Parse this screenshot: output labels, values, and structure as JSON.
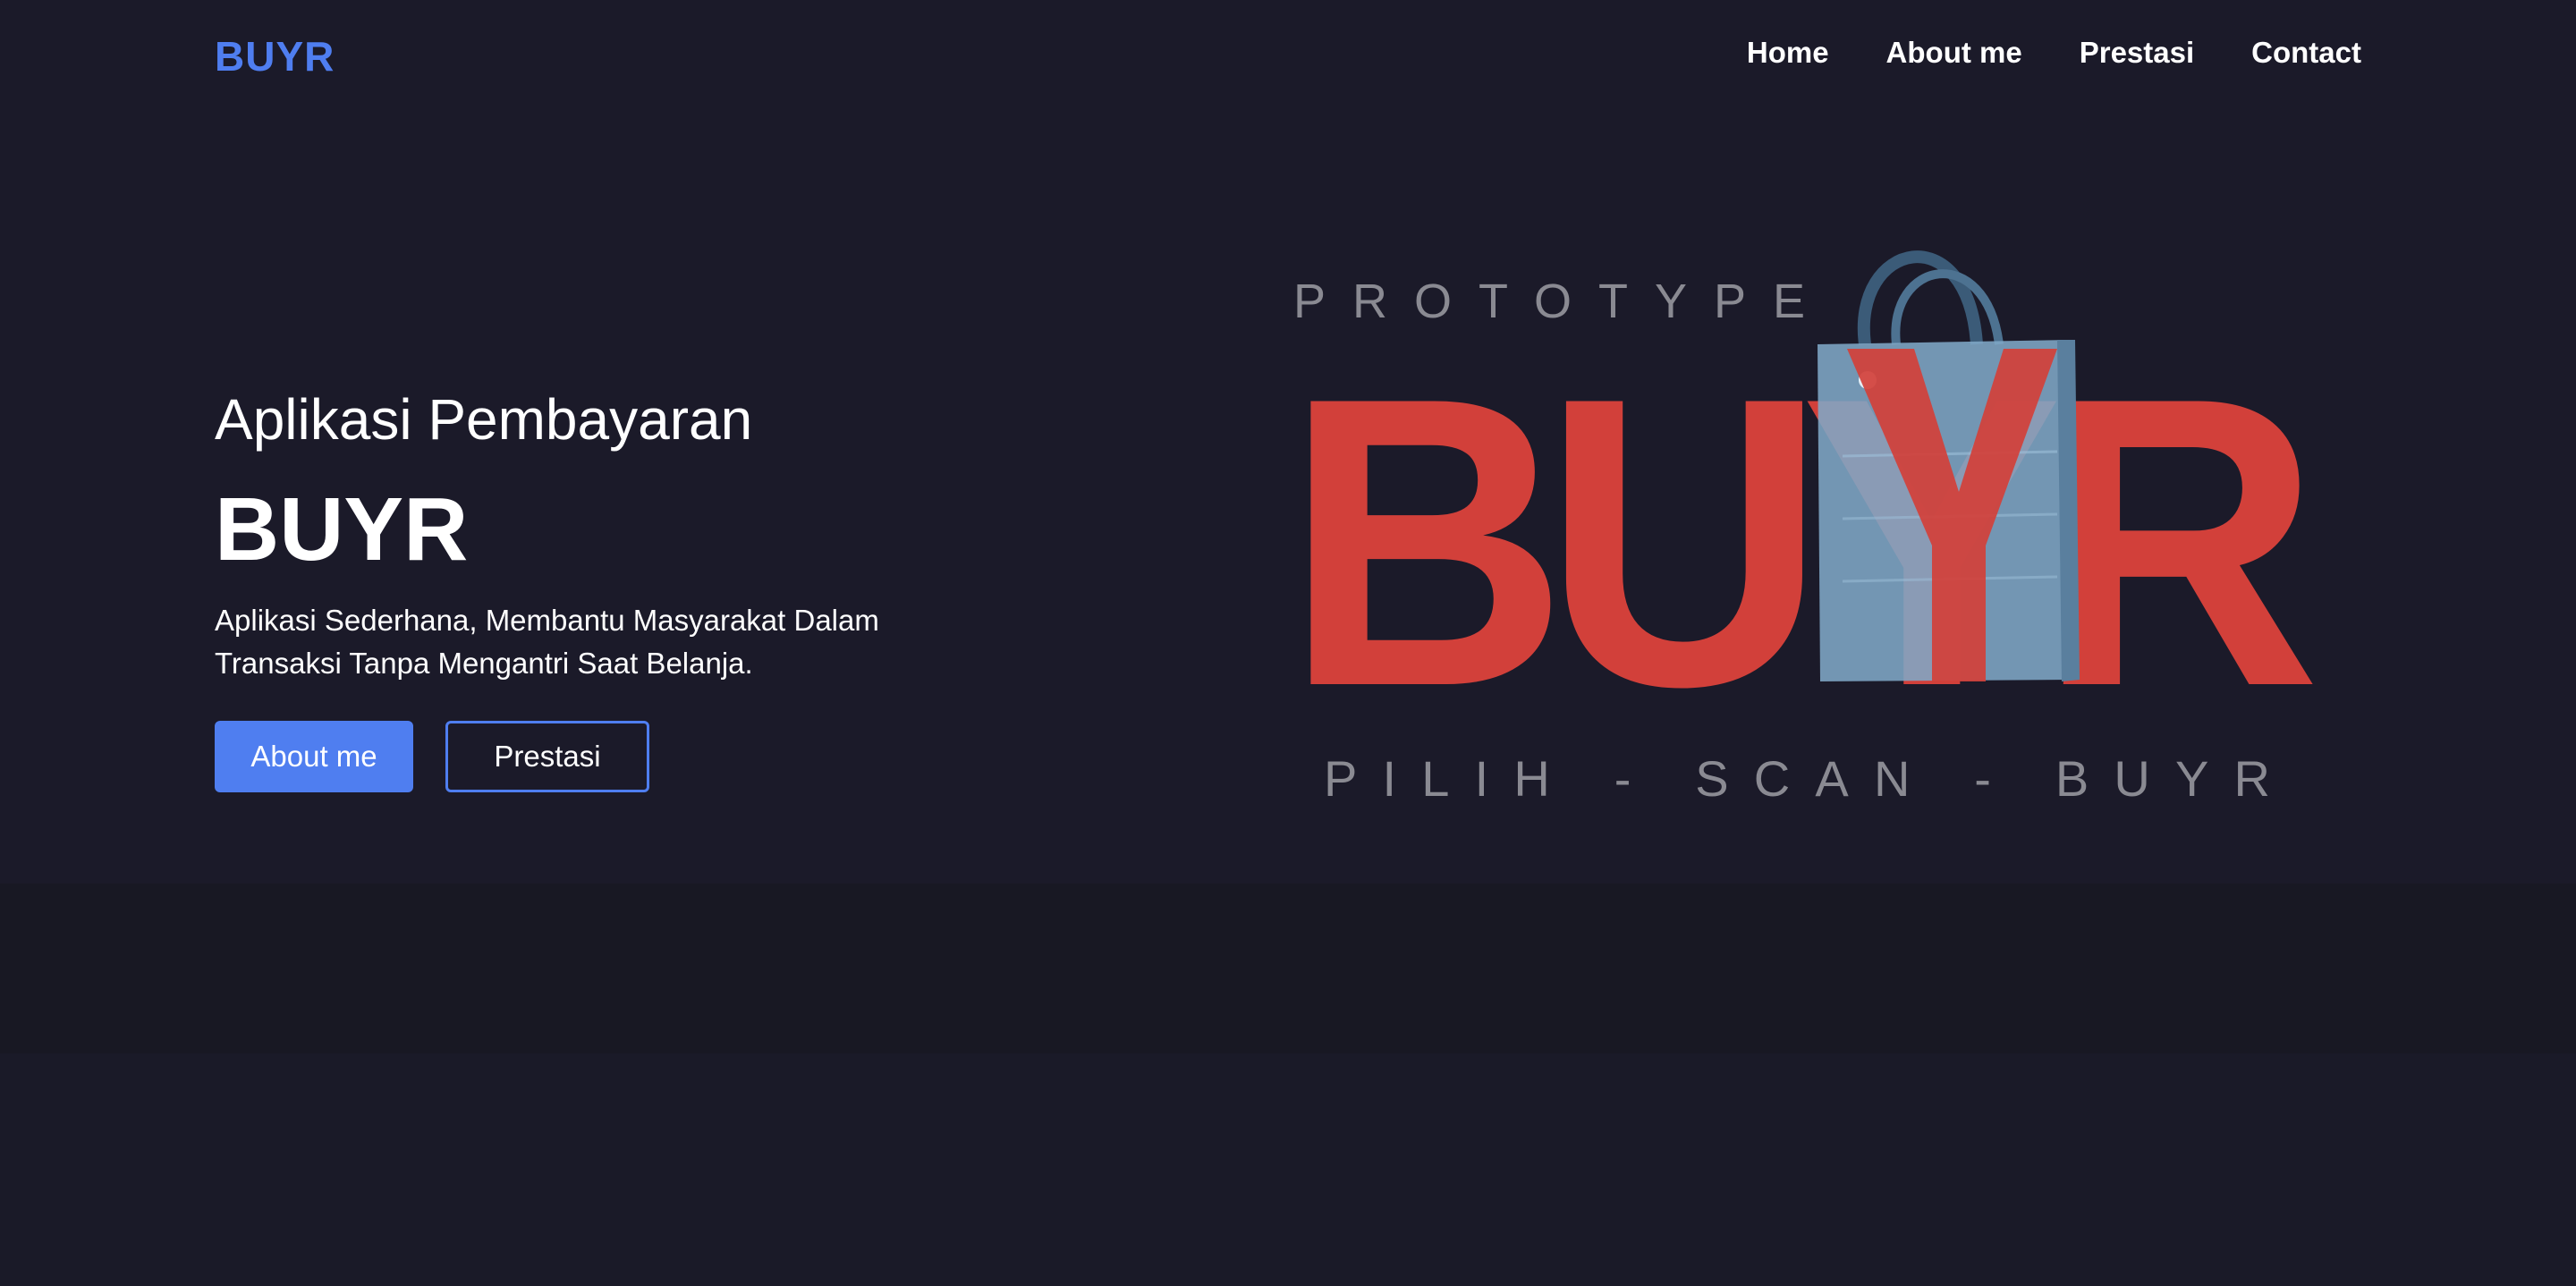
{
  "header": {
    "brand": "BUYR",
    "nav": [
      "Home",
      "About me",
      "Prestasi",
      "Contact"
    ]
  },
  "hero": {
    "subtitle": "Aplikasi Pembayaran",
    "title": "BUYR",
    "description": "Aplikasi Sederhana, Membantu Masyarakat Dalam Transaksi Tanpa Mengantri Saat Belanja.",
    "buttons": {
      "primary": "About me",
      "secondary": "Prestasi"
    }
  },
  "logo": {
    "top_text": "PROTOTYPE",
    "main_text": "BUYR",
    "tagline": "PILIH - SCAN - BUYR",
    "icon": "shopping-bag-icon"
  },
  "colors": {
    "background": "#1b1a29",
    "accent": "#4f7ef0",
    "logo_red": "#d2403a",
    "bag_blue": "#7fa7c6",
    "logo_text_gray": "#8a8a92"
  }
}
